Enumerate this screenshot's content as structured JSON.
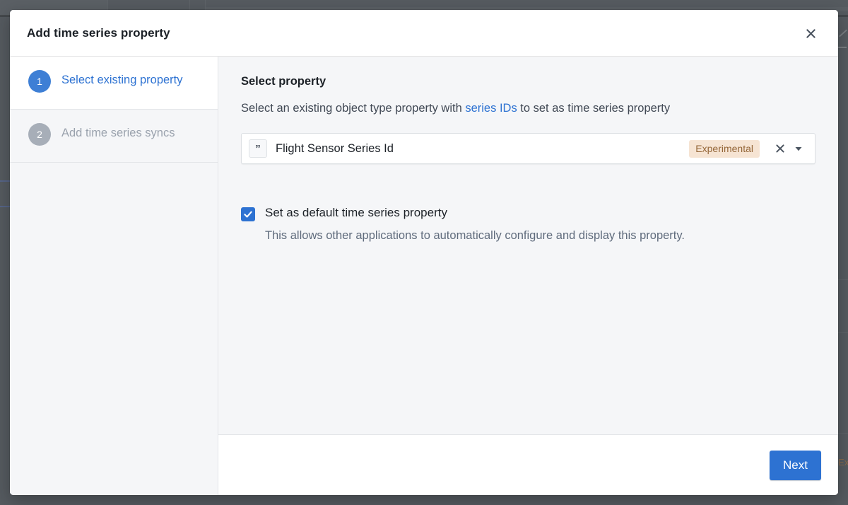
{
  "dialog": {
    "title": "Add time series property",
    "close_icon": "close-icon"
  },
  "steps": [
    {
      "number": "1",
      "label": "Select existing property",
      "state": "active"
    },
    {
      "number": "2",
      "label": "Add time series syncs",
      "state": "pending"
    }
  ],
  "content": {
    "section_title": "Select property",
    "desc_before": "Select an existing object type property with ",
    "desc_link": "series IDs",
    "desc_after": " to set as time series property",
    "select": {
      "type_icon_glyph": "”",
      "value": "Flight Sensor Series Id",
      "tag": "Experimental",
      "clear_icon": "close-icon",
      "caret_icon": "chevron-down-icon"
    },
    "checkbox": {
      "checked": true,
      "label": "Set as default time series property",
      "help": "This allows other applications to automatically configure and display this property."
    }
  },
  "footer": {
    "next_label": "Next"
  },
  "background": {
    "ghost_badge": "Experimental"
  },
  "colors": {
    "accent_blue": "#2d72d2",
    "step_active_blue": "#3e7fd5",
    "step_pending_gray": "#a7aeb8",
    "tag_bg": "#f6e4d3",
    "tag_fg": "#946638",
    "panel_bg": "#f5f6f8",
    "overlay": "#565b60"
  }
}
